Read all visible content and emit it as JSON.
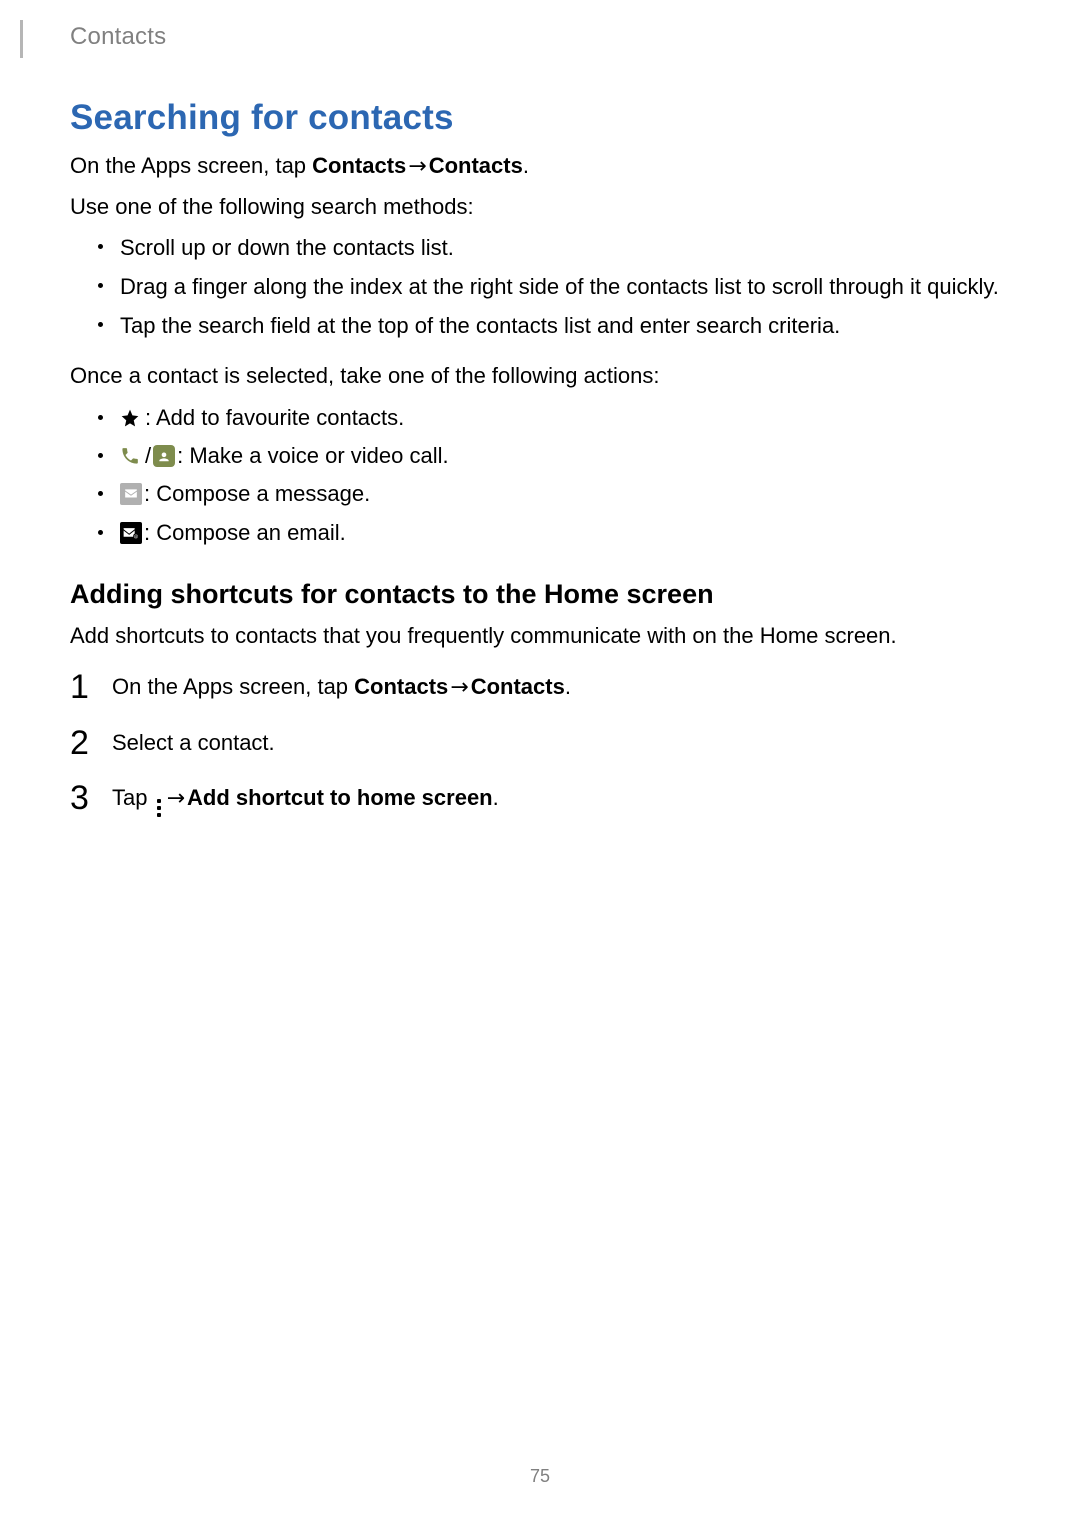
{
  "header": {
    "breadcrumb": "Contacts"
  },
  "section": {
    "title": "Searching for contacts",
    "intro_pre": "On the Apps screen, tap ",
    "intro_bold1": "Contacts",
    "intro_arrow": " → ",
    "intro_bold2": "Contacts",
    "intro_post": ".",
    "methods_intro": "Use one of the following search methods:",
    "methods": [
      "Scroll up or down the contacts list.",
      "Drag a finger along the index at the right side of the contacts list to scroll through it quickly.",
      "Tap the search field at the top of the contacts list and enter search criteria."
    ],
    "actions_intro": "Once a contact is selected, take one of the following actions:",
    "actions": {
      "fav": " : Add to favourite contacts.",
      "call_sep": " / ",
      "call": " : Make a voice or video call.",
      "msg": " : Compose a message.",
      "email": " : Compose an email."
    },
    "sub_title": "Adding shortcuts for contacts to the Home screen",
    "sub_intro": "Add shortcuts to contacts that you frequently communicate with on the Home screen.",
    "steps": {
      "s1_pre": "On the Apps screen, tap ",
      "s1_b1": "Contacts",
      "s1_arrow": " → ",
      "s1_b2": "Contacts",
      "s1_post": ".",
      "s2": "Select a contact.",
      "s3_pre": "Tap ",
      "s3_arrow": " → ",
      "s3_bold": "Add shortcut to home screen",
      "s3_post": "."
    }
  },
  "page_number": "75"
}
